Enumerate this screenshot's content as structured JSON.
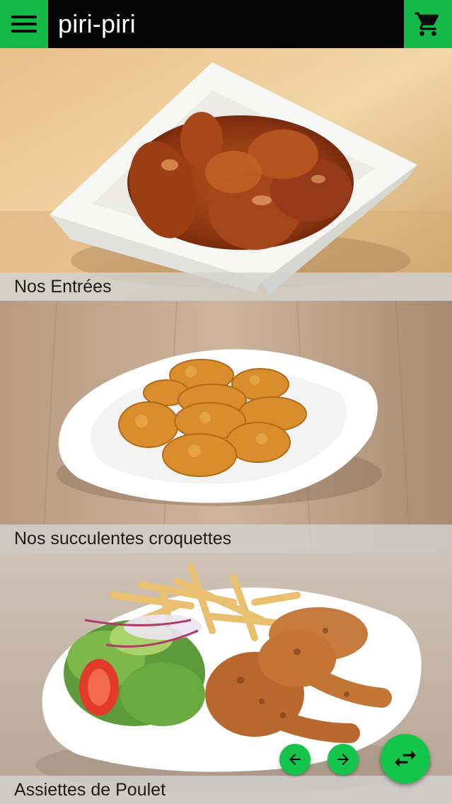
{
  "app": {
    "title": "piri-piri",
    "accent_color": "#14b94a"
  },
  "topbar": {
    "menu_icon": "hamburger-menu-icon",
    "cart_icon": "shopping-cart-icon"
  },
  "categories": [
    {
      "label": "Nos Entrées",
      "image": "chicken-wings-bowl"
    },
    {
      "label": "Nos succulentes croquettes",
      "image": "chicken-nuggets-plate"
    },
    {
      "label": "Assiettes de Poulet",
      "image": "grilled-chicken-fries-salad-plate"
    }
  ],
  "controls": {
    "prev_icon": "arrow-left-icon",
    "next_icon": "arrow-right-icon",
    "swap_icon": "swap-arrows-icon"
  }
}
